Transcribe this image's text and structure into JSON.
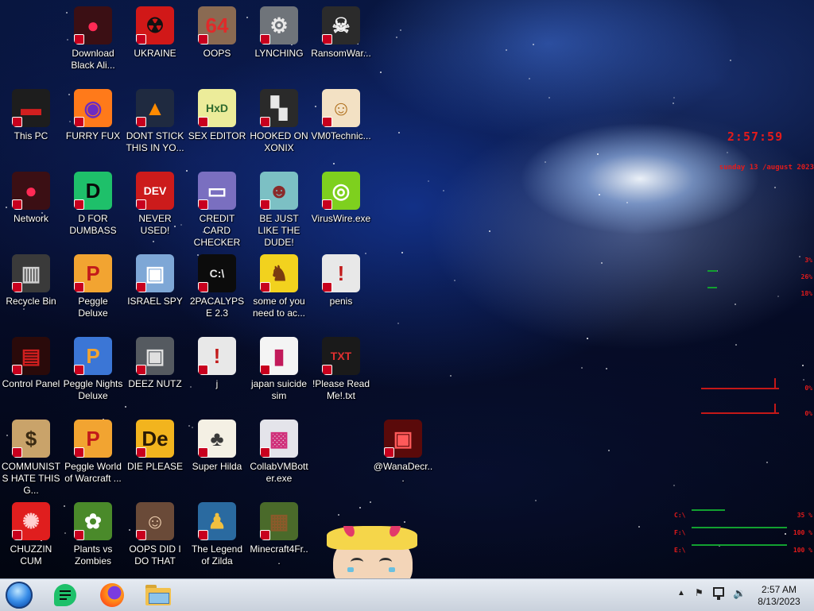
{
  "desktop": {
    "icons": [
      {
        "label": "Download Black Ali...",
        "icon": "black-alien-icon",
        "bg": "#3b0f14",
        "glyph": "●",
        "fg": "#ff2a55"
      },
      {
        "label": "UKRAINE",
        "icon": "radiation-icon",
        "bg": "#d11818",
        "glyph": "☢",
        "fg": "#111111"
      },
      {
        "label": "OOPS",
        "icon": "portrait-64-icon",
        "bg": "#8a6a52",
        "glyph": "64",
        "fg": "#e02a2a"
      },
      {
        "label": "LYNCHING",
        "icon": "noose-icon",
        "bg": "#6f747a",
        "glyph": "⚙",
        "fg": "#e9e9e9"
      },
      {
        "label": "RansomWar...",
        "icon": "skull-headphones-icon",
        "bg": "#2b2b2b",
        "glyph": "☠",
        "fg": "#f2f2f2"
      },
      {
        "label": "This PC",
        "icon": "computer-icon",
        "bg": "#1d1d1d",
        "glyph": "▬",
        "fg": "#d11f1f"
      },
      {
        "label": "FURRY FUX",
        "icon": "firefox-icon",
        "bg": "#ff7a1a",
        "glyph": "◉",
        "fg": "#6b2cc2"
      },
      {
        "label": "DONT STICK THIS IN YO...",
        "icon": "vlc-cone-icon",
        "bg": "#1f2a40",
        "glyph": "▲",
        "fg": "#ff8a00"
      },
      {
        "label": "SEX EDITOR",
        "icon": "hxd-icon",
        "bg": "#ecec9a",
        "glyph": "HxD",
        "fg": "#2e6a2e"
      },
      {
        "label": "HOOKED ON XONIX",
        "icon": "xonix-icon",
        "bg": "#2a2a2a",
        "glyph": "▚",
        "fg": "#e8e8e8"
      },
      {
        "label": "VM0Technic...",
        "icon": "doctor-icon",
        "bg": "#f3e1c4",
        "glyph": "☺",
        "fg": "#b0701e"
      },
      {
        "label": "Network",
        "icon": "network-alien-icon",
        "bg": "#3b0f14",
        "glyph": "●",
        "fg": "#ff2a55"
      },
      {
        "label": "D FOR DUMBASS",
        "icon": "chat-bubble-icon",
        "bg": "#1ec06a",
        "glyph": "D",
        "fg": "#0a0a0a"
      },
      {
        "label": "NEVER USED!",
        "icon": "devcpp-icon",
        "bg": "#cc1b1b",
        "glyph": "DEV",
        "fg": "#ffffff"
      },
      {
        "label": "CREDIT CARD CHECKER",
        "icon": "credit-card-icon",
        "bg": "#7a6fc0",
        "glyph": "▭",
        "fg": "#ffffff"
      },
      {
        "label": "BE JUST LIKE THE DUDE!",
        "icon": "dude-icon",
        "bg": "#7cc0c4",
        "glyph": "☻",
        "fg": "#8a2a2a"
      },
      {
        "label": "VirusWire.exe",
        "icon": "limewire-icon",
        "bg": "#7ed01e",
        "glyph": "◎",
        "fg": "#ffffff"
      },
      {
        "label": "Recycle Bin",
        "icon": "recycle-bin-icon",
        "bg": "#3a3a3a",
        "glyph": "▥",
        "fg": "#cfcfcf"
      },
      {
        "label": "Peggle Deluxe",
        "icon": "peggle-icon",
        "bg": "#f2a431",
        "glyph": "P",
        "fg": "#c21a1a"
      },
      {
        "label": "ISRAEL SPY",
        "icon": "network-computers-icon",
        "bg": "#7ea7d6",
        "glyph": "▣",
        "fg": "#ffffff"
      },
      {
        "label": "2PACALYPSE 2.3",
        "icon": "terminal-icon",
        "bg": "#0c0c0c",
        "glyph": "C:\\",
        "fg": "#e8e8e8"
      },
      {
        "label": "some of you need to ac...",
        "icon": "beaver-icon",
        "bg": "#f2d21e",
        "glyph": "♞",
        "fg": "#7a3b10"
      },
      {
        "label": "penis",
        "icon": "blank-file-icon",
        "bg": "#e8e8e8",
        "glyph": "!",
        "fg": "#c21a1a"
      },
      {
        "label": "Control Panel",
        "icon": "control-panel-icon",
        "bg": "#2a0a0a",
        "glyph": "▤",
        "fg": "#d11f1f"
      },
      {
        "label": "Peggle Nights Deluxe",
        "icon": "peggle-nights-icon",
        "bg": "#3b76d6",
        "glyph": "P",
        "fg": "#f2a431"
      },
      {
        "label": "DEEZ NUTZ",
        "icon": "windows-stack-icon",
        "bg": "#555a60",
        "glyph": "▣",
        "fg": "#dfdfdf"
      },
      {
        "label": "j",
        "icon": "blank-file-icon",
        "bg": "#e8e8e8",
        "glyph": "!",
        "fg": "#c21a1a"
      },
      {
        "label": "japan suicide sim",
        "icon": "file-icon",
        "bg": "#f4f4f4",
        "glyph": "▮",
        "fg": "#c21a5a"
      },
      {
        "label": "!Please Read Me!.txt",
        "icon": "txt-file-icon",
        "bg": "#1a1a1a",
        "glyph": "TXT",
        "fg": "#e23030"
      },
      {
        "label": "COMMUNISTS HATE THIS G...",
        "icon": "money-bag-icon",
        "bg": "#c9a36a",
        "glyph": "$",
        "fg": "#3a2a12"
      },
      {
        "label": "Peggle World of Warcraft ...",
        "icon": "peggle-wow-icon",
        "bg": "#f2a431",
        "glyph": "P",
        "fg": "#c21a1a"
      },
      {
        "label": "DIE PLEASE",
        "icon": "adobe-de-icon",
        "bg": "#f2b41e",
        "glyph": "De",
        "fg": "#2a1a05"
      },
      {
        "label": "Super Hilda",
        "icon": "pixel-dog-icon",
        "bg": "#f4f0e4",
        "glyph": "♣",
        "fg": "#3a3a3a"
      },
      {
        "label": "CollabVMBotter.exe",
        "icon": "monitor-icon",
        "bg": "#e4e4ea",
        "glyph": "▩",
        "fg": "#d0307a"
      },
      {
        "label": "@WanaDecr...",
        "icon": "wanadecryptor-icon",
        "bg": "#5a0a0a",
        "glyph": "▣",
        "fg": "#ff5a5a"
      },
      {
        "label": "CHUZZIN CUM",
        "icon": "chuzzle-icon",
        "bg": "#e01e1e",
        "glyph": "✺",
        "fg": "#ffd0d0"
      },
      {
        "label": "Plants vs Zombies",
        "icon": "plants-vs-zombies-icon",
        "bg": "#4a8a2a",
        "glyph": "✿",
        "fg": "#ffffff"
      },
      {
        "label": "OOPS DID I DO THAT",
        "icon": "portrait-icon",
        "bg": "#6a4a38",
        "glyph": "☺",
        "fg": "#f0d0b0"
      },
      {
        "label": "The Legend of Zilda",
        "icon": "pixel-hero-icon",
        "bg": "#2a6aa0",
        "glyph": "♟",
        "fg": "#f0c040"
      },
      {
        "label": "Minecraft4Fr...",
        "icon": "minecraft-block-icon",
        "bg": "#4a6a2a",
        "glyph": "▦",
        "fg": "#8a5a2a"
      }
    ]
  },
  "widgets": {
    "clock_time": "2:57:59",
    "clock_date": "sunday 13 /august 2023",
    "cpu_stats": [
      "3%",
      "26%",
      "18%"
    ],
    "net_stats": [
      "0%",
      "0%"
    ],
    "drives": [
      {
        "label": "C:\\",
        "percent": "35 %",
        "fill": 0.35
      },
      {
        "label": "F:\\",
        "percent": "100 %",
        "fill": 1.0
      },
      {
        "label": "E:\\",
        "percent": "100 %",
        "fill": 1.0
      }
    ]
  },
  "taskbar": {
    "pinned": [
      {
        "name": "chat-app",
        "icon": "chat-bubble-icon",
        "color": "#1ec06a"
      },
      {
        "name": "firefox",
        "icon": "firefox-icon",
        "color": "#ff7a1a"
      },
      {
        "name": "file-explorer",
        "icon": "folder-icon",
        "color": "#f2c14e"
      }
    ],
    "time": "2:57 AM",
    "date": "8/13/2023"
  }
}
